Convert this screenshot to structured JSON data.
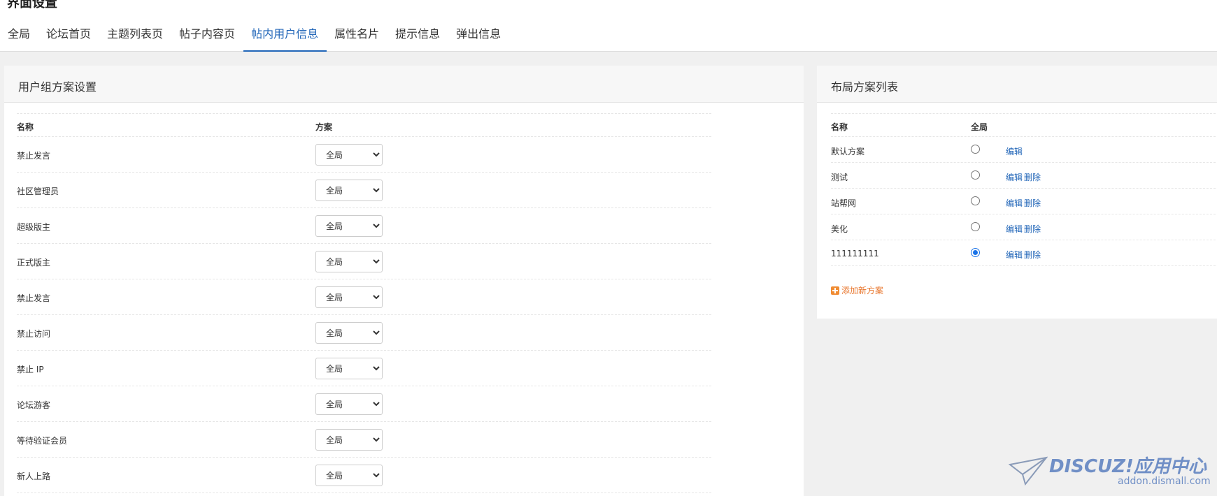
{
  "page": {
    "title": "界面设置"
  },
  "tabs": [
    "全局",
    "论坛首页",
    "主题列表页",
    "帖子内容页",
    "帖内用户信息",
    "属性名片",
    "提示信息",
    "弹出信息"
  ],
  "active_tab": "帖内用户信息",
  "left_panel": {
    "title": "用户组方案设置",
    "col_name": "名称",
    "col_scheme": "方案",
    "rows": [
      {
        "name": "禁止发言",
        "value": "全局"
      },
      {
        "name": "社区管理员",
        "value": "全局"
      },
      {
        "name": "超级版主",
        "value": "全局"
      },
      {
        "name": "正式版主",
        "value": "全局"
      },
      {
        "name": "禁止发言",
        "value": "全局"
      },
      {
        "name": "禁止访问",
        "value": "全局"
      },
      {
        "name": "禁止 IP",
        "value": "全局"
      },
      {
        "name": "论坛游客",
        "value": "全局"
      },
      {
        "name": "等待验证会员",
        "value": "全局"
      },
      {
        "name": "新人上路",
        "value": "全局"
      }
    ]
  },
  "right_panel": {
    "title": "布局方案列表",
    "col_name": "名称",
    "col_global": "全局",
    "edit_label": "编辑",
    "delete_label": "删除",
    "rows": [
      {
        "name": "默认方案",
        "selected": false,
        "deletable": false
      },
      {
        "name": "测试",
        "selected": false,
        "deletable": true
      },
      {
        "name": "站帮网",
        "selected": false,
        "deletable": true
      },
      {
        "name": "美化",
        "selected": false,
        "deletable": true
      },
      {
        "name": "111111111",
        "selected": true,
        "deletable": true
      }
    ],
    "add_label": "添加新方案"
  },
  "watermark": {
    "brand": "DISCUZ!应用中心",
    "site": "addon.dismall.com"
  },
  "colors": {
    "accent": "#2266b8",
    "add_orange": "#e8742a"
  }
}
